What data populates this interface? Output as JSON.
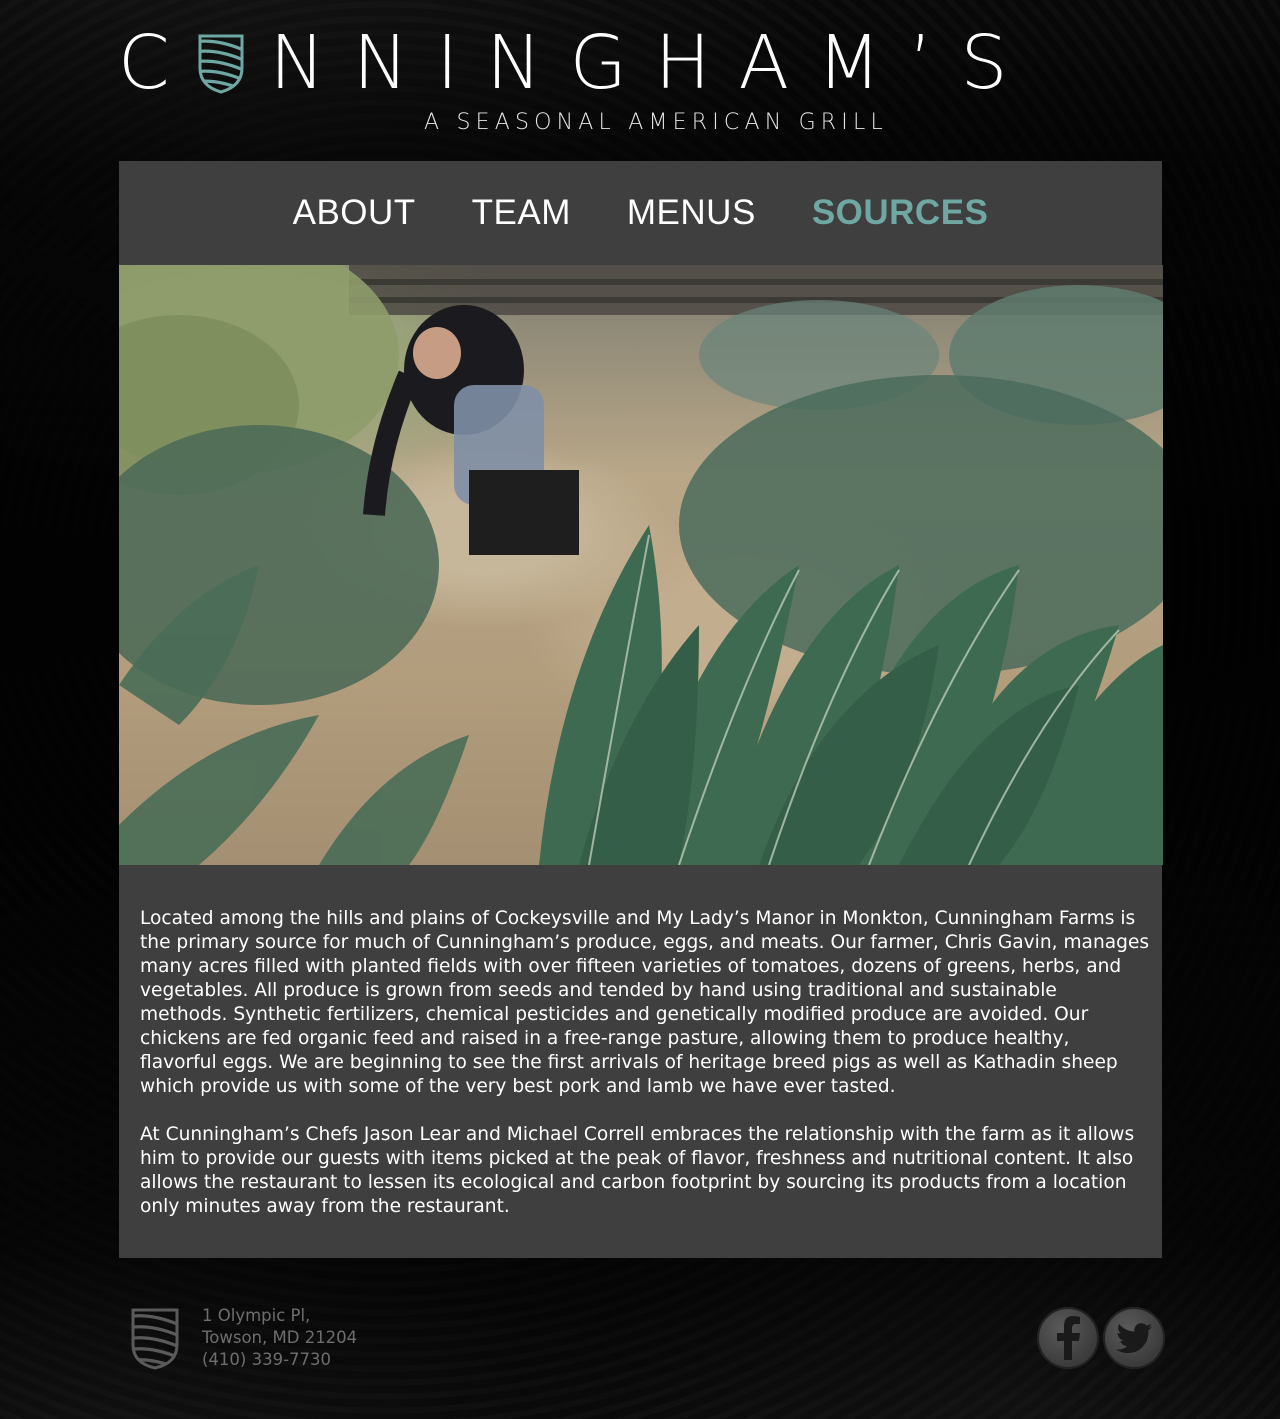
{
  "header": {
    "logo_word_left": "C",
    "logo_word_right": "NNINGHAM’S",
    "tagline": "A SEASONAL AMERICAN GRILL"
  },
  "nav": {
    "items": [
      {
        "label": "ABOUT",
        "active": false
      },
      {
        "label": "TEAM",
        "active": false
      },
      {
        "label": "MENUS",
        "active": false
      },
      {
        "label": "SOURCES",
        "active": true
      }
    ],
    "active_color": "#6fa7a3"
  },
  "content": {
    "paragraphs": [
      "Located among the hills and plains of Cockeysville and My Lady’s Manor in Monkton, Cunningham Farms is the primary source for much of Cunningham’s produce, eggs, and meats. Our farmer, Chris Gavin, manages many acres filled with planted fields with over fifteen varieties of tomatoes, dozens of greens, herbs, and vegetables. All produce is grown from seeds and tended by hand using traditional and sustainable methods. Synthetic fertilizers, chemical pesticides and genetically modified produce are avoided. Our chickens are fed organic feed and raised in a free-range pasture, allowing them to produce healthy, flavorful eggs. We are beginning to see the first arrivals of heritage breed pigs as well as Kathadin sheep which provide us with some of the very best pork and lamb we have ever tasted.",
      "At Cunningham’s Chefs Jason Lear and Michael Correll embraces the relationship with the farm as it allows him to provide our guests with items picked at the peak of flavor, freshness and nutritional content. It also allows the restaurant to lessen its ecological and carbon footprint by sourcing its products from a location only minutes away from the restaurant."
    ]
  },
  "footer": {
    "address_line1": "1 Olympic Pl,",
    "address_line2": "Towson, MD 21204",
    "phone": "(410) 339-7730",
    "social": [
      {
        "name": "facebook-icon"
      },
      {
        "name": "twitter-icon"
      }
    ]
  },
  "colors": {
    "accent_teal": "#6fa7a3",
    "panel_gray": "#3f3f3f",
    "footer_text": "#6e6e6e"
  }
}
